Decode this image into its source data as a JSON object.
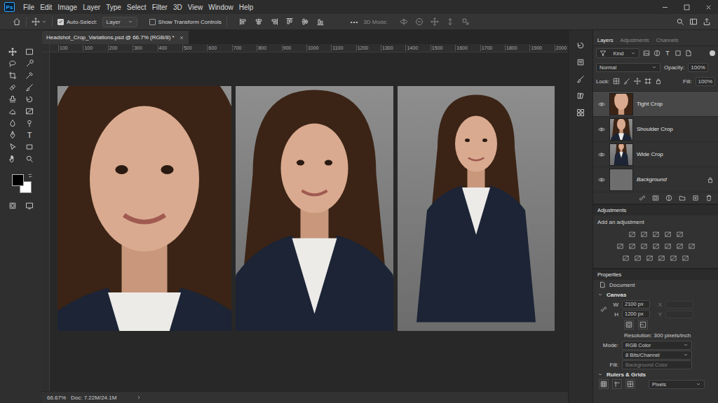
{
  "app": {
    "logo": "Ps",
    "type_glyph": "T"
  },
  "menu": [
    "File",
    "Edit",
    "Image",
    "Layer",
    "Type",
    "Select",
    "Filter",
    "3D",
    "View",
    "Window",
    "Help"
  ],
  "options_bar": {
    "auto_select": {
      "label": "Auto-Select:",
      "checked": true
    },
    "target": "Layer",
    "transform_controls": {
      "label": "Show Transform Controls",
      "checked": false
    },
    "more": "•••",
    "mode_3d": "3D Mode:"
  },
  "document_tab": {
    "title": "Headshot_Crop_Variations.psd @ 66.7% (RGB/8) *"
  },
  "ruler": {
    "ticks": [
      "100",
      "100",
      "200",
      "300",
      "400",
      "500",
      "600",
      "700",
      "800",
      "900",
      "1000",
      "1100",
      "1200",
      "1300",
      "1400",
      "1500",
      "1600",
      "1700",
      "1800",
      "1900",
      "2000"
    ]
  },
  "layers_panel": {
    "tabs": [
      {
        "label": "Layers",
        "selected": true
      },
      {
        "label": "Adjustments",
        "selected": false
      },
      {
        "label": "Channels",
        "selected": false
      }
    ],
    "filter": "Kind",
    "blend_mode": "Normal",
    "opacity": {
      "label": "Opacity:",
      "value": "100%"
    },
    "lock": "Lock:",
    "fill": {
      "label": "Fill:",
      "value": "100%"
    },
    "layers": [
      {
        "name": "Tight Crop",
        "kind": "photo",
        "visible": true,
        "selected": true,
        "locked": false
      },
      {
        "name": "Shoulder Crop",
        "kind": "photo",
        "visible": true,
        "selected": false,
        "locked": false
      },
      {
        "name": "Wide Crop",
        "kind": "photo",
        "visible": true,
        "selected": false,
        "locked": false
      },
      {
        "name": "Background",
        "kind": "background",
        "visible": true,
        "selected": false,
        "locked": true
      }
    ]
  },
  "adjustments_panel": {
    "title": "Adjustments",
    "hint": "Add an adjustment"
  },
  "properties_panel": {
    "title": "Properties",
    "kind": "Document",
    "canvas_section": {
      "label": "Canvas",
      "expanded": true
    },
    "width": {
      "label": "W",
      "value": "2100",
      "unit": "px"
    },
    "height": {
      "label": "H",
      "value": "1200",
      "unit": "px"
    },
    "x_label": "X",
    "y_label": "Y",
    "resolution": "Resolution: 300 pixels/inch",
    "mode": {
      "label": "Mode:",
      "value": "RGB Color"
    },
    "depth": "8 Bits/Channel",
    "fill": {
      "label": "Fill:",
      "value": "Background Color"
    },
    "rulers_section": {
      "label": "Rulers & Grids",
      "expanded": true
    },
    "units": "Pixels"
  },
  "status_bar": {
    "zoom": "66.67%",
    "doc": "Doc: 7.22M/24.1M"
  }
}
